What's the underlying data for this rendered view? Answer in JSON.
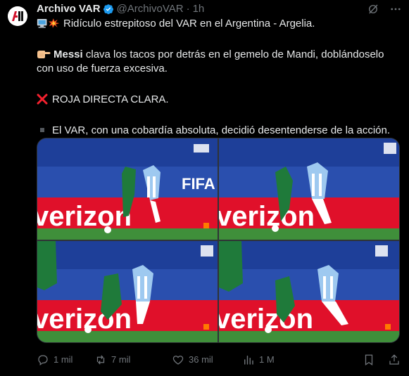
{
  "tweet": {
    "author_name": "Archivo VAR",
    "handle": "@ArchivoVAR",
    "separator": "·",
    "time": "1h",
    "line1": "Ridículo estrepitoso del VAR en el Argentina - Argelia.",
    "line2_bold": "Messi",
    "line2_rest": " clava los tacos por detrás en el gemelo de Mandi, doblándoselo con uso de fuerza excesiva.",
    "line3": "ROJA DIRECTA CLARA.",
    "line4": "El VAR, con una cobardía absoluta, decidió desentenderse de la acción."
  },
  "media": {
    "banner_text": "verizon",
    "backdrop_text": "FIFA"
  },
  "actions": {
    "replies": "1 mil",
    "reposts": "7 mil",
    "likes": "36 mil",
    "views": "1 M"
  },
  "icons": {
    "avatar": "archivo-var-logo",
    "verified": "verified-badge-icon",
    "grok": "grok-icon",
    "more": "more-icon",
    "reply": "reply-icon",
    "repost": "repost-icon",
    "like": "heart-icon",
    "views": "views-icon",
    "bookmark": "bookmark-icon",
    "share": "share-icon",
    "line1_emoji": "computer-and-collision-emoji",
    "line2_emoji": "pointing-hand-emoji",
    "line3_emoji": "cross-mark-emoji",
    "line4_emoji": "black-square-emoji"
  },
  "colors": {
    "background": "#000000",
    "text": "#e7e9ea",
    "muted": "#71767b",
    "verified": "#1d9bf0",
    "cross": "#f4212e",
    "pitch": "#3f8f3a",
    "stands": "#2a4fae",
    "banner": "#e0102a"
  }
}
